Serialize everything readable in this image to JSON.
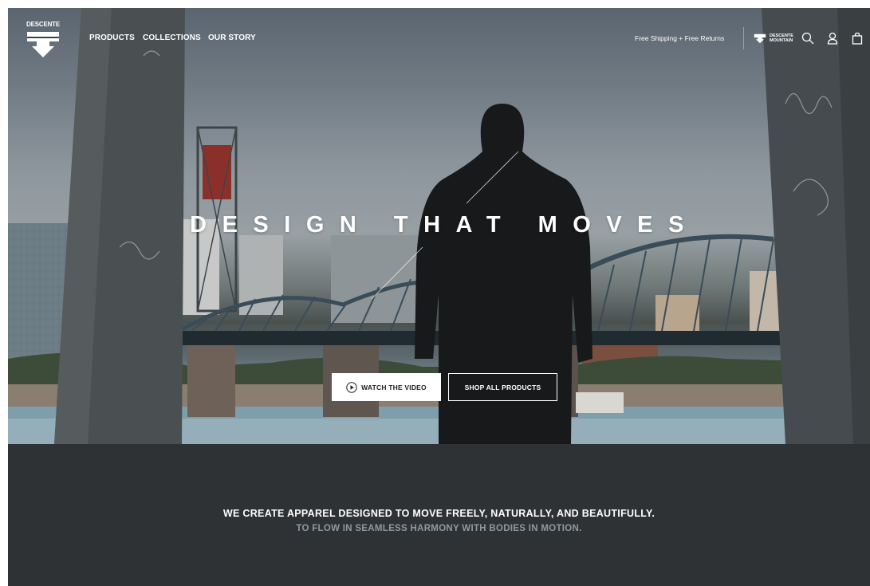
{
  "brand": {
    "wordmark": "DESCENTE",
    "sub_brand": [
      "DESCENTE",
      "MOUNTAIN"
    ]
  },
  "nav": {
    "items": [
      {
        "label": "PRODUCTS"
      },
      {
        "label": "COLLECTIONS"
      },
      {
        "label": "OUR STORY"
      }
    ],
    "promo": "Free Shipping + Free Returns",
    "icons": [
      "search-icon",
      "account-icon",
      "shopping-bag-icon"
    ]
  },
  "hero": {
    "headline": "DESIGN THAT MOVES",
    "cta_watch": "WATCH THE VIDEO",
    "cta_shop": "SHOP ALL PRODUCTS"
  },
  "mission": {
    "line1": "WE CREATE APPAREL DESIGNED TO MOVE FREELY, NATURALLY, AND BEAUTIFULLY.",
    "line2": "TO FLOW IN SEAMLESS HARMONY WITH BODIES IN MOTION."
  },
  "colors": {
    "band_background": "#2f3235",
    "secondary_text": "#8e98a3",
    "primary_text": "#ffffff"
  }
}
